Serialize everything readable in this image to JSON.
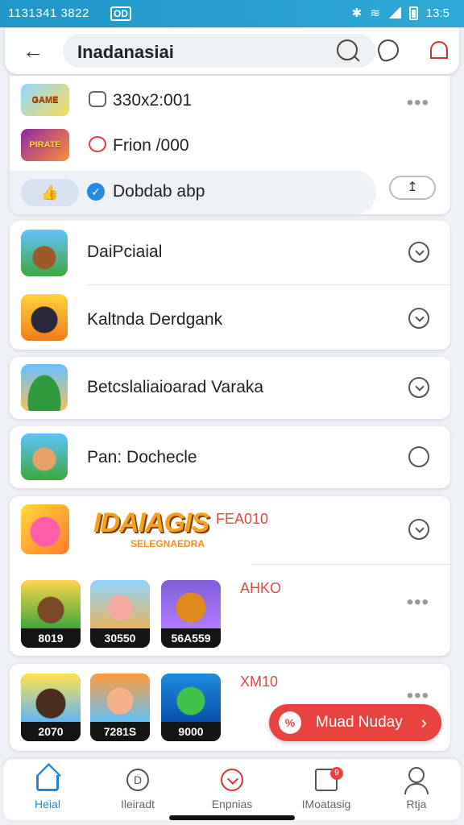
{
  "status_bar": {
    "time": "1131341 3822",
    "badge": "OD",
    "clock": "13:5"
  },
  "top_bar": {
    "title": "Inadanasiai"
  },
  "account_card": {
    "row1_text": "330x2:001",
    "row1_logo": "GAME",
    "row2_text": "Frion /000",
    "row2_logo": "PIRATE",
    "action_text": "Dobdab abp",
    "thumb_icon": "👍",
    "upload_label": "↥"
  },
  "games": [
    {
      "name": "DaiPciaial"
    },
    {
      "name": "Kaltnda Derdgank"
    },
    {
      "name": "Betcslaliaioarad Varaka"
    },
    {
      "name": "Pan: Dochecle"
    }
  ],
  "featured": {
    "logo": "IDAIAGIS",
    "logo_sub": "SELEGNAEDRA",
    "price_top": "FEA010",
    "price_mid": "AHKO",
    "price_bottom": "XM10",
    "tiles_row1": [
      "8019",
      "30550",
      "56A559"
    ],
    "tiles_row2": [
      "2070",
      "7281S",
      "9000"
    ]
  },
  "cta": {
    "label": "Muad Nuday",
    "icon_text": "%"
  },
  "nav": [
    {
      "label": "Heial",
      "icon": "home-icon"
    },
    {
      "label": "Ileiradt",
      "icon": "d-circle-icon"
    },
    {
      "label": "Enpnias",
      "icon": "heart-check-icon"
    },
    {
      "label": "IMoatasig",
      "icon": "message-icon",
      "badge": "9"
    },
    {
      "label": "Rtja",
      "icon": "user-icon"
    }
  ],
  "colors": {
    "accent": "#1f88d6",
    "status_bar": "#2fa9d6",
    "cta": "#e8433f"
  }
}
